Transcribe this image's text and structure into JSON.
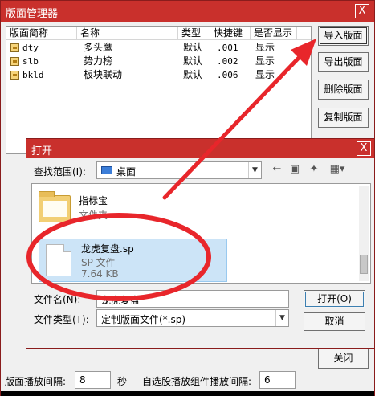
{
  "manager": {
    "title": "版面管理器",
    "close_label": "X",
    "columns": [
      "版面简称",
      "名称",
      "类型",
      "快捷键",
      "是否显示"
    ],
    "rows": [
      {
        "short": "dty",
        "name": "多头鹰",
        "type": "默认",
        "hotkey": ".001",
        "visible": "显示"
      },
      {
        "short": "slb",
        "name": "势力榜",
        "type": "默认",
        "hotkey": ".002",
        "visible": "显示"
      },
      {
        "short": "bkld",
        "name": "板块联动",
        "type": "默认",
        "hotkey": ".006",
        "visible": "显示"
      }
    ],
    "buttons": {
      "import": "导入版面",
      "export": "导出版面",
      "delete": "删除版面",
      "copy": "复制版面",
      "close": "关闭"
    },
    "bottom": {
      "interval_label": "版面播放间隔:",
      "interval_value": "8",
      "interval_unit": "秒",
      "component_label": "自选股播放组件播放间隔:",
      "component_value": "6"
    }
  },
  "open_dialog": {
    "title": "打开",
    "close_label": "X",
    "lookin_label": "查找范围(I):",
    "lookin_value": "桌面",
    "folder_item": {
      "name": "指标宝",
      "type": "文件夹"
    },
    "file_item": {
      "name": "龙虎复盘.sp",
      "type": "SP 文件",
      "size": "7.64 KB"
    },
    "filename_label": "文件名(N):",
    "filename_value": "龙虎复盘",
    "filetype_label": "文件类型(T):",
    "filetype_value": "定制版面文件(*.sp)",
    "open_button": "打开(O)",
    "cancel_button": "取消"
  },
  "colors": {
    "titlebar": "#c9302c",
    "annotation": "#e8262b",
    "selection": "#cce4f7"
  },
  "icons": [
    "close-icon",
    "folder-icon",
    "back-icon",
    "up-folder-icon",
    "new-folder-icon",
    "view-menu-icon",
    "document-icon",
    "dropdown-icon"
  ]
}
